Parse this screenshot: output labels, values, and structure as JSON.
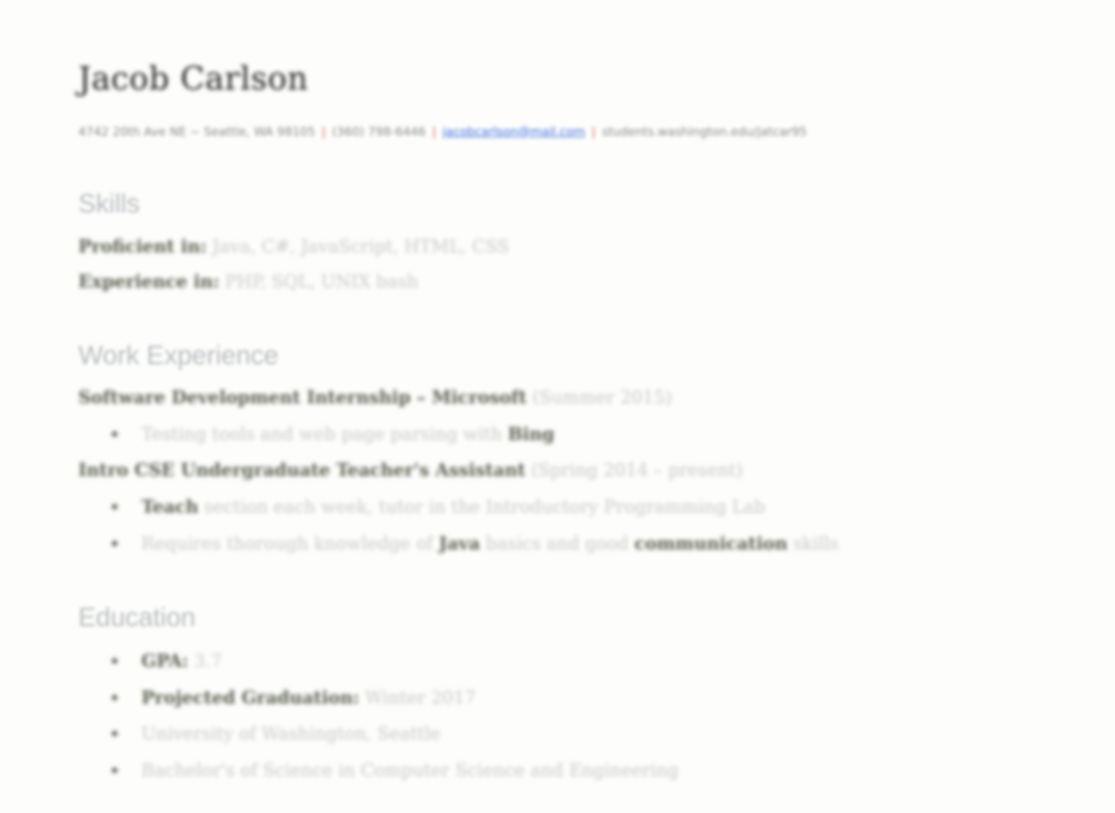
{
  "resume": {
    "name": "Jacob Carlson",
    "contact": {
      "address": "4742 20th Ave NE ~ Seattle, WA 98105",
      "phone": "(360) 798-6446",
      "email": "jacobcarlson@mail.com",
      "website": "students.washington.edu/jatcar95"
    },
    "skills": {
      "heading": "Skills",
      "proficient_label": "Proficient in:",
      "proficient_value": "Java, C#, JavaScript, HTML, CSS",
      "experience_label": "Experience in:",
      "experience_value": "PHP, SQL, UNIX bash"
    },
    "work": {
      "heading": "Work Experience",
      "job1": {
        "title": "Software Development Internship – Microsoft",
        "dates": "(Summer 2015)",
        "b1_pre": "Testing tools and web page parsing with",
        "b1_bold": "Bing"
      },
      "job2": {
        "title": "Intro CSE Undergraduate Teacher's Assistant",
        "dates": "(Spring 2014 – present)",
        "b1_bold": "Teach",
        "b1_post": "section each week, tutor in the Introductory Programming Lab",
        "b2_pre": "Requires thorough knowledge of",
        "b2_bold1": "Java",
        "b2_mid": "basics and good",
        "b2_bold2": "communication",
        "b2_post": "skills"
      }
    },
    "education": {
      "heading": "Education",
      "gpa_label": "GPA:",
      "gpa_value": "3.7",
      "grad_label": "Projected Graduation:",
      "grad_value": "Winter 2017",
      "school": "University of Washington, Seattle",
      "degree": "Bachelor's of Science in Computer Science and Engineering"
    }
  }
}
